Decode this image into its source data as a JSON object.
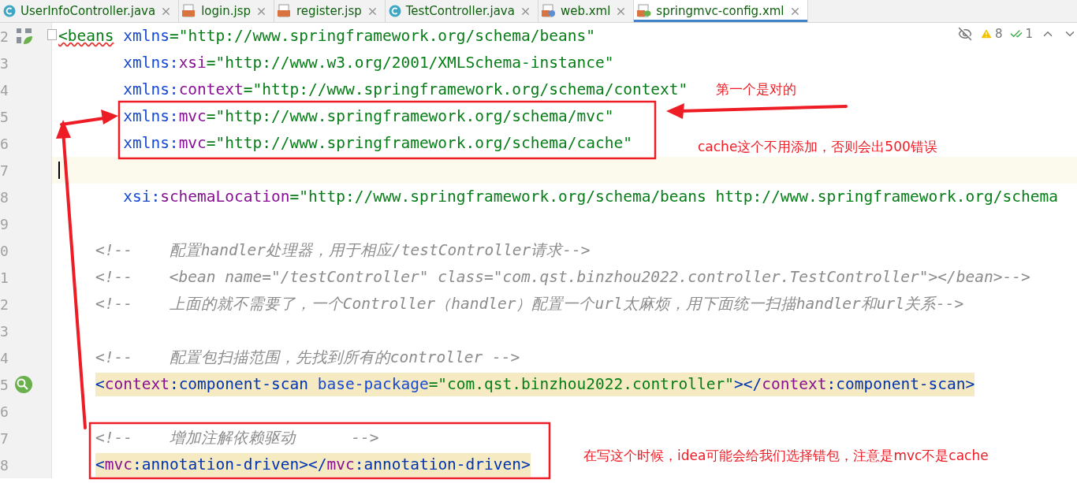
{
  "tabs": [
    {
      "label": "UserInfoController.java",
      "kind": "class",
      "selected": false
    },
    {
      "label": "login.jsp",
      "kind": "jsp",
      "selected": false
    },
    {
      "label": "register.jsp",
      "kind": "jsp",
      "selected": false
    },
    {
      "label": "TestController.java",
      "kind": "class",
      "selected": false
    },
    {
      "label": "web.xml",
      "kind": "webxml",
      "selected": false
    },
    {
      "label": "springmvc-config.xml",
      "kind": "springxml",
      "selected": true
    }
  ],
  "inspections": {
    "warnings": "8",
    "weak_warnings": "1"
  },
  "lines": [
    {
      "number": "2",
      "kind": "root",
      "current": false,
      "marked": false,
      "tokens": [
        {
          "kind": "unresolved",
          "text": "<beans"
        },
        {
          "kind": "attr",
          "text": " xmlns"
        },
        {
          "kind": "value",
          "text": "=\"http://www.springframework.org/schema/beans\""
        }
      ]
    },
    {
      "number": "3",
      "kind": "attr",
      "current": false,
      "marked": false,
      "tokens": [
        {
          "kind": "attr",
          "text": "xmlns:"
        },
        {
          "kind": "ns",
          "text": "xsi"
        },
        {
          "kind": "value",
          "text": "=\"http://www.w3.org/2001/XMLSchema-instance\""
        }
      ]
    },
    {
      "number": "4",
      "kind": "attr",
      "current": false,
      "marked": false,
      "tokens": [
        {
          "kind": "attr",
          "text": "xmlns:"
        },
        {
          "kind": "ns",
          "text": "context"
        },
        {
          "kind": "value",
          "text": "=\"http://www.springframework.org/schema/context\""
        }
      ]
    },
    {
      "number": "5",
      "kind": "attr",
      "current": false,
      "marked": false,
      "tokens": [
        {
          "kind": "attr",
          "text": "xmlns:"
        },
        {
          "kind": "ns",
          "text": "mvc"
        },
        {
          "kind": "value",
          "text": "=\"http://www.springframework.org/schema/mvc\""
        }
      ]
    },
    {
      "number": "6",
      "kind": "attr",
      "current": false,
      "marked": false,
      "tokens": [
        {
          "kind": "attr",
          "text": "xmlns:"
        },
        {
          "kind": "ns",
          "text": "mvc"
        },
        {
          "kind": "value",
          "text": "=\"http://www.springframework.org/schema/cache\""
        }
      ]
    },
    {
      "number": "7",
      "kind": "blank",
      "current": true,
      "marked": false
    },
    {
      "number": "8",
      "kind": "attr",
      "current": false,
      "marked": false,
      "tokens": [
        {
          "kind": "attr",
          "text": "xsi:"
        },
        {
          "kind": "ns",
          "text": "schemaLocation"
        },
        {
          "kind": "value",
          "text": "=\"http://www.springframework.org/schema/beans http://www.springframework.org/schema"
        }
      ]
    },
    {
      "number": "9",
      "kind": "blank",
      "current": false,
      "marked": false
    },
    {
      "number": "0",
      "kind": "child",
      "current": false,
      "marked": false,
      "tokens": [
        {
          "kind": "comment",
          "text": "<!--    配置handler处理器，用于相应/testController请求-->"
        }
      ]
    },
    {
      "number": "1",
      "kind": "child",
      "current": false,
      "marked": false,
      "tokens": [
        {
          "kind": "comment",
          "text": "<!--    <bean name=\"/testController\" class=\"com.qst.binzhou2022.controller.TestController\"></bean>-->"
        }
      ]
    },
    {
      "number": "2",
      "kind": "child",
      "current": false,
      "marked": false,
      "tokens": [
        {
          "kind": "comment",
          "text": "<!--    上面的就不需要了，一个Controller（handler）配置一个url太麻烦，用下面统一扫描handler和url关系-->"
        }
      ]
    },
    {
      "number": "3",
      "kind": "blank",
      "current": false,
      "marked": false
    },
    {
      "number": "4",
      "kind": "child",
      "current": false,
      "marked": false,
      "tokens": [
        {
          "kind": "comment",
          "text": "<!--    配置包扫描范围，先找到所有的controller -->"
        }
      ]
    },
    {
      "number": "5",
      "kind": "scan",
      "current": false,
      "marked": true,
      "tokens": [
        {
          "kind": "tag",
          "text": "<"
        },
        {
          "kind": "ns",
          "text": "context"
        },
        {
          "kind": "tag",
          "text": ":component-scan"
        },
        {
          "kind": "attr",
          "text": " base-package"
        },
        {
          "kind": "value",
          "text": "=\"com.qst.binzhou2022.controller\""
        },
        {
          "kind": "tag",
          "text": "></"
        },
        {
          "kind": "ns",
          "text": "context"
        },
        {
          "kind": "tag",
          "text": ":component-scan>"
        }
      ]
    },
    {
      "number": "6",
      "kind": "blank",
      "current": false,
      "marked": false
    },
    {
      "number": "7",
      "kind": "child",
      "current": false,
      "marked": false,
      "tokens": [
        {
          "kind": "comment",
          "text": "<!--    增加注解依赖驱动      -->"
        }
      ]
    },
    {
      "number": "8",
      "kind": "child",
      "current": false,
      "marked": true,
      "tokens": [
        {
          "kind": "tag",
          "text": "<"
        },
        {
          "kind": "ns",
          "text": "mvc"
        },
        {
          "kind": "tag",
          "text": ":annotation-driven></"
        },
        {
          "kind": "ns",
          "text": "mvc"
        },
        {
          "kind": "tag",
          "text": ":annotation-driven>"
        }
      ]
    }
  ],
  "notes": [
    {
      "text": "第一个是对的"
    },
    {
      "text": "cache这个不用添加，否则会出500错误"
    },
    {
      "text": "在写这个时候，idea可能会给我们选择错包，注意是mvc不是cache"
    }
  ]
}
